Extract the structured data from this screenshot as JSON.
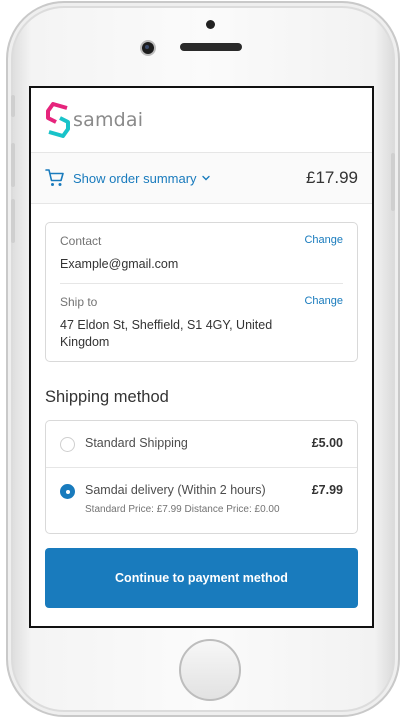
{
  "brand": {
    "name": "samdai",
    "accent": "#197bbd"
  },
  "summary": {
    "toggle_label": "Show order summary",
    "total": "£17.99"
  },
  "review": {
    "contact": {
      "label": "Contact",
      "value": "Example@gmail.com",
      "change": "Change"
    },
    "ship_to": {
      "label": "Ship to",
      "value": "47 Eldon St, Sheffield, S1 4GY, United Kingdom",
      "change": "Change"
    }
  },
  "shipping": {
    "title": "Shipping method",
    "options": [
      {
        "name": "Standard Shipping",
        "price": "£5.00",
        "description": "",
        "selected": false
      },
      {
        "name": "Samdai delivery (Within 2 hours)",
        "price": "£7.99",
        "description": "Standard Price: £7.99 Distance Price: £0.00",
        "selected": true
      }
    ]
  },
  "actions": {
    "continue_label": "Continue to payment method"
  }
}
